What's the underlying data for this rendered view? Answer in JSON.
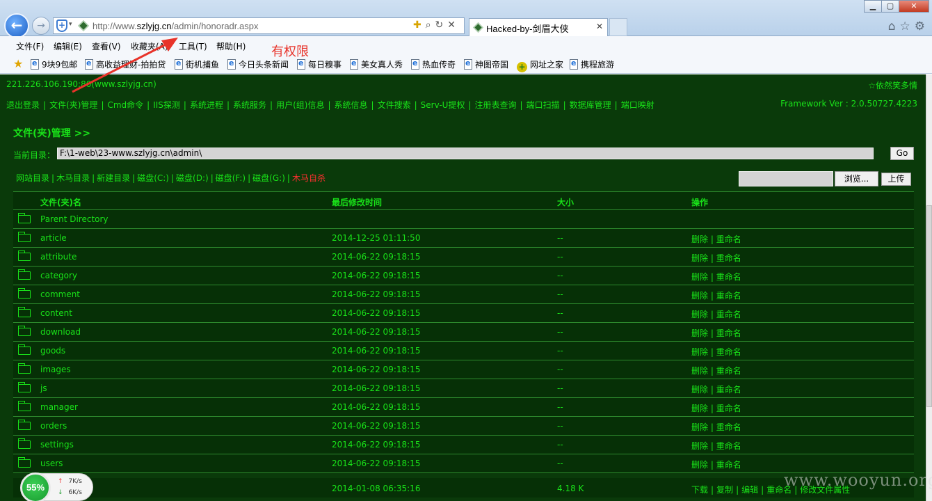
{
  "browser": {
    "url_prefix": "http://www.",
    "url_domain": "szlyjg.cn",
    "url_path": "/admin/honoradr.aspx",
    "tab_title": "Hacked-by-剑眉大侠",
    "menu": [
      "文件(F)",
      "编辑(E)",
      "查看(V)",
      "收藏夹(A)",
      "工具(T)",
      "帮助(H)"
    ],
    "favorites": [
      "9块9包邮",
      "高收益理财-拍拍贷",
      "街机捕鱼",
      "今日头条新闻",
      "每日糗事",
      "美女真人秀",
      "热血传奇",
      "神图帝国",
      "网址之家",
      "携程旅游"
    ]
  },
  "annotation": {
    "text": "有权限",
    "color": "#e8332a"
  },
  "shell": {
    "host": "221.226.106.190:80(www.szlyjg.cn)",
    "signature": "☆依然笑多情",
    "menu": [
      "退出登录",
      "文件(夹)管理",
      "Cmd命令",
      "IIS探测",
      "系统进程",
      "系统服务",
      "用户(组)信息",
      "系统信息",
      "文件搜索",
      "Serv-U提权",
      "注册表查询",
      "端口扫描",
      "数据库管理",
      "端口映射"
    ],
    "framework": "Framework Ver : 2.0.50727.4223",
    "section_title": "文件(夹)管理 >>",
    "current_dir_label": "当前目录：",
    "current_dir": "F:\\1-web\\23-www.szlyjg.cn\\admin\\",
    "go_label": "Go",
    "dir_links": [
      "网站目录",
      "木马目录",
      "新建目录",
      "磁盘(C:)",
      "磁盘(D:)",
      "磁盘(F:)",
      "磁盘(G:)"
    ],
    "self_delete": "木马自杀",
    "browse_label": "浏览...",
    "upload_label": "上传",
    "columns": {
      "name": "文件(夹)名",
      "time": "最后修改时间",
      "size": "大小",
      "op": "操作"
    },
    "parent": "Parent Directory",
    "delete": "删除",
    "rename": "重命名",
    "folders": [
      {
        "name": "article",
        "time": "2014-12-25 01:11:50",
        "size": "--"
      },
      {
        "name": "attribute",
        "time": "2014-06-22 09:18:15",
        "size": "--"
      },
      {
        "name": "category",
        "time": "2014-06-22 09:18:15",
        "size": "--"
      },
      {
        "name": "comment",
        "time": "2014-06-22 09:18:15",
        "size": "--"
      },
      {
        "name": "content",
        "time": "2014-06-22 09:18:15",
        "size": "--"
      },
      {
        "name": "download",
        "time": "2014-06-22 09:18:15",
        "size": "--"
      },
      {
        "name": "goods",
        "time": "2014-06-22 09:18:15",
        "size": "--"
      },
      {
        "name": "images",
        "time": "2014-06-22 09:18:15",
        "size": "--"
      },
      {
        "name": "js",
        "time": "2014-06-22 09:18:15",
        "size": "--"
      },
      {
        "name": "manager",
        "time": "2014-06-22 09:18:15",
        "size": "--"
      },
      {
        "name": "orders",
        "time": "2014-06-22 09:18:15",
        "size": "--"
      },
      {
        "name": "settings",
        "time": "2014-06-22 09:18:15",
        "size": "--"
      },
      {
        "name": "users",
        "time": "2014-06-22 09:18:15",
        "size": "--"
      }
    ],
    "file_row": {
      "time": "2014-01-08 06:35:16",
      "size": "4.18 K",
      "ops": [
        "下载",
        "复制",
        "编辑",
        "重命名",
        "修改文件属性"
      ]
    }
  },
  "speed_widget": {
    "percent": "55%",
    "up": "7K/s",
    "down": "6K/s"
  },
  "watermark": "www.wooyun.org"
}
